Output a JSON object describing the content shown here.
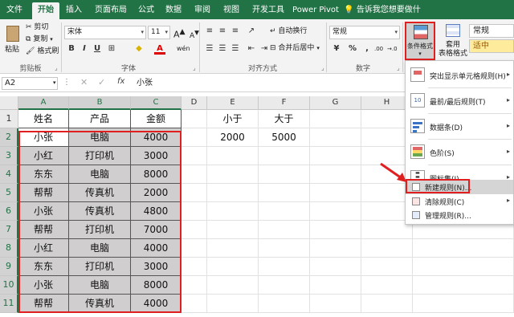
{
  "ribbon_tabs": [
    "文件",
    "开始",
    "插入",
    "页面布局",
    "公式",
    "数据",
    "审阅",
    "视图",
    "开发工具",
    "Power Pivot"
  ],
  "active_tab": "开始",
  "tell_me": "告诉我您想要做什么",
  "clipboard": {
    "paste": "粘贴",
    "cut": "剪切",
    "copy": "复制",
    "format_painter": "格式刷",
    "label": "剪贴板"
  },
  "font": {
    "name": "宋体",
    "size": "11",
    "grow": "A",
    "shrink": "A",
    "label": "字体",
    "wen": "wén"
  },
  "alignment": {
    "wrap_text": "自动换行",
    "merge_center": "合并后居中",
    "label": "对齐方式"
  },
  "number": {
    "format": "常规",
    "percent": "%",
    "comma": ",",
    "label": "数字",
    "inc_decimal": ".00",
    "dec_decimal": "→.0"
  },
  "styles": {
    "conditional_formatting": "条件格式",
    "format_as_table_1": "套用",
    "format_as_table_2": "表格格式",
    "style_normal": "常规",
    "style_neutral": "适中"
  },
  "formula_bar": {
    "name_box": "A2",
    "value": "小张"
  },
  "columns": [
    "A",
    "B",
    "C",
    "D",
    "E",
    "F",
    "G",
    "H"
  ],
  "rows": [
    "1",
    "2",
    "3",
    "4",
    "5",
    "6",
    "7",
    "8",
    "9",
    "10",
    "11"
  ],
  "table": {
    "headers": [
      "姓名",
      "产品",
      "金额"
    ],
    "rows": [
      [
        "小张",
        "电脑",
        "4000"
      ],
      [
        "小红",
        "打印机",
        "3000"
      ],
      [
        "东东",
        "电脑",
        "8000"
      ],
      [
        "帮帮",
        "传真机",
        "2000"
      ],
      [
        "小张",
        "传真机",
        "4800"
      ],
      [
        "帮帮",
        "打印机",
        "7000"
      ],
      [
        "小红",
        "电脑",
        "4000"
      ],
      [
        "东东",
        "打印机",
        "3000"
      ],
      [
        "小张",
        "电脑",
        "8000"
      ],
      [
        "帮帮",
        "传真机",
        "4000"
      ]
    ]
  },
  "criteria": {
    "less_label": "小于",
    "greater_label": "大于",
    "less_value": "2000",
    "greater_value": "5000"
  },
  "cf_menu": {
    "items": [
      {
        "label": "突出显示单元格规则(H)",
        "has_submenu": true
      },
      {
        "label": "最前/最后规则(T)",
        "has_submenu": true
      },
      {
        "label": "数据条(D)",
        "has_submenu": true
      },
      {
        "label": "色阶(S)",
        "has_submenu": true
      },
      {
        "label": "图标集(I)",
        "has_submenu": true
      }
    ],
    "new_rule": "新建规则(N)...",
    "clear_rules": "清除规则(C)",
    "manage_rules": "管理规则(R)..."
  },
  "colors": {
    "accent": "#217346",
    "highlight_red": "#e02020",
    "data_fill": "#d0cece"
  }
}
